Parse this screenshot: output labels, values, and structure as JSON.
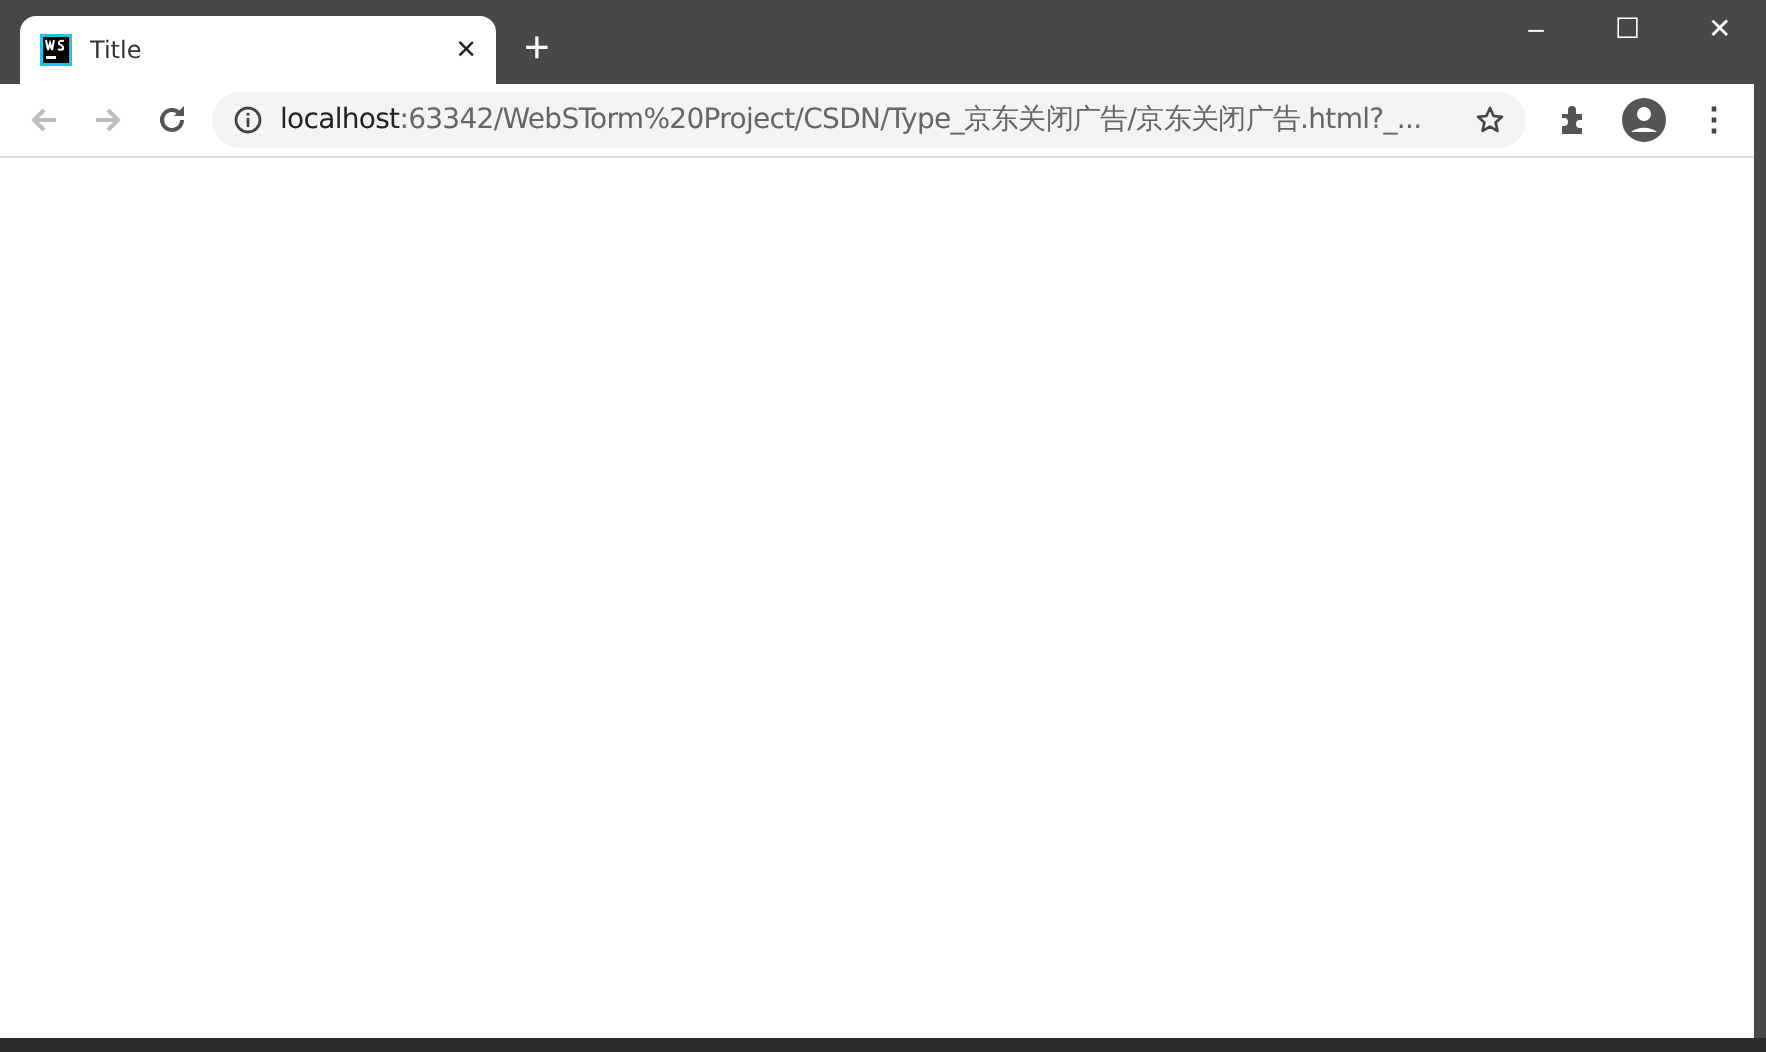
{
  "tab": {
    "title": "Title",
    "close": "×",
    "selected": true
  },
  "new_tab": "+",
  "window_controls": {
    "minimize": "–",
    "maximize": "☐",
    "close": "✕"
  },
  "address_bar": {
    "host": "localhost",
    "path": ":63342/WebSTorm%20Project/CSDN/Type_京东关闭广告/京东关闭广告.html?_..."
  },
  "menu": "⋮"
}
